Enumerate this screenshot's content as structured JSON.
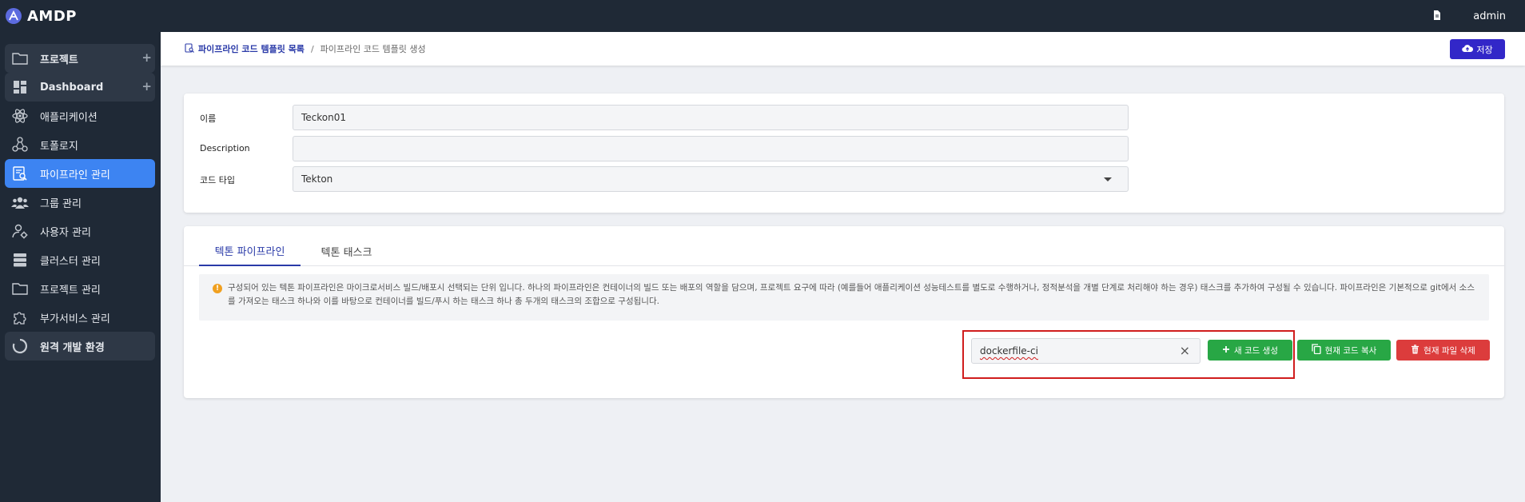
{
  "app": {
    "logo_text": "AMDP",
    "user_name": "admin"
  },
  "sidebar": {
    "items": [
      {
        "label": "프로젝트",
        "icon": "folder-icon",
        "has_plus": true,
        "style": "group"
      },
      {
        "label": "Dashboard",
        "icon": "dashboard-icon",
        "has_plus": true,
        "style": "group"
      },
      {
        "label": "애플리케이션",
        "icon": "atom-icon",
        "style": "plain"
      },
      {
        "label": "토폴로지",
        "icon": "topology-icon",
        "style": "plain"
      },
      {
        "label": "파이프라인 관리",
        "icon": "pipeline-icon",
        "style": "active"
      },
      {
        "label": "그룹 관리",
        "icon": "group-icon",
        "style": "plain"
      },
      {
        "label": "사용자 관리",
        "icon": "user-settings-icon",
        "style": "plain"
      },
      {
        "label": "클러스터 관리",
        "icon": "server-icon",
        "style": "plain"
      },
      {
        "label": "프로젝트 관리",
        "icon": "folder-icon",
        "style": "plain"
      },
      {
        "label": "부가서비스 관리",
        "icon": "puzzle-icon",
        "style": "plain"
      },
      {
        "label": "원격 개발 환경",
        "icon": "spinner-icon",
        "style": "group"
      }
    ]
  },
  "header": {
    "breadcrumb_link": "파이프라인 코드 템플릿 목록",
    "breadcrumb_separator": "/",
    "breadcrumb_current": "파이프라인 코드 템플릿 생성",
    "save_label": "저장"
  },
  "form": {
    "name_label": "이름",
    "name_value": "Teckon01",
    "description_label": "Description",
    "description_value": "",
    "code_type_label": "코드 타입",
    "code_type_value": "Tekton"
  },
  "tabs": [
    {
      "label": "텍톤 파이프라인",
      "active": true
    },
    {
      "label": "텍톤 태스크",
      "active": false
    }
  ],
  "info": {
    "icon": "!",
    "text": "구성되어 있는 텍톤 파이프라인은 마이크로서비스 빌드/배포시 선택되는 단위 입니다. 하나의 파이프라인은 컨테이너의 빌드 또는 배포의 역할을 담으며, 프로젝트 요구에 따라 (예를들어 애플리케이션 성능테스트를 별도로 수행하거나, 정적분석을 개별 단계로 처리해야 하는 경우) 태스크를 추가하여 구성될 수 있습니다. 파이프라인은 기본적으로 git에서 소스를 가져오는 태스크 하나와 이를 바탕으로 컨테이너를 빌드/푸시 하는 태스크 하나 총 두개의 태스크의 조합으로 구성됩니다."
  },
  "actions": {
    "file_name": "dockerfile-ci",
    "clear_symbol": "×",
    "new_code_label": "새 코드 생성",
    "copy_code_label": "현재 코드 복사",
    "delete_file_label": "현재 파일 삭제"
  },
  "colors": {
    "sidebar_bg": "#1f2936",
    "active_item": "#3d84f2",
    "primary": "#3227c8",
    "success": "#28a745",
    "danger": "#dc3c3c",
    "highlight_border": "#d01d1d"
  }
}
